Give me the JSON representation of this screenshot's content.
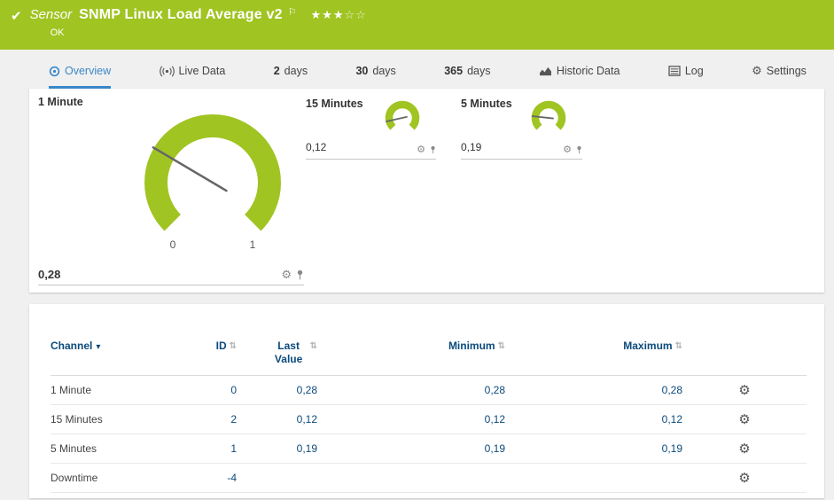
{
  "colors": {
    "brand_green": "#a0c422",
    "link_blue": "#3a87c8",
    "navy": "#0b4a7c"
  },
  "header": {
    "check_icon": "✔",
    "kind": "Sensor",
    "title": "SNMP Linux Load Average v2",
    "flag_icon": "⚐",
    "stars_filled": "★★★",
    "stars_empty": "☆☆",
    "status": "OK"
  },
  "tabs": [
    {
      "label": "Overview",
      "active": true
    },
    {
      "label": "Live Data"
    },
    {
      "prefix": "2",
      "label": "days"
    },
    {
      "prefix": "30",
      "label": "days"
    },
    {
      "prefix": "365",
      "label": "days"
    },
    {
      "label": "Historic Data"
    },
    {
      "label": "Log"
    },
    {
      "label": "Settings"
    }
  ],
  "gauges": {
    "primary": {
      "label": "1 Minute",
      "value": "0,28",
      "value_num": 0.28,
      "scale_min": "0",
      "scale_max": "1"
    },
    "small": [
      {
        "label": "15 Minutes",
        "value": "0,12",
        "value_num": 0.12
      },
      {
        "label": "5 Minutes",
        "value": "0,19",
        "value_num": 0.19
      }
    ]
  },
  "icons": {
    "gear": "⚙",
    "sort": "⇅",
    "caret": "▾"
  },
  "table": {
    "headers": {
      "channel": "Channel",
      "id": "ID",
      "last": "Last Value",
      "min": "Minimum",
      "max": "Maximum"
    },
    "rows": [
      {
        "channel": "1 Minute",
        "id": "0",
        "last": "0,28",
        "min": "0,28",
        "max": "0,28"
      },
      {
        "channel": "15 Minutes",
        "id": "2",
        "last": "0,12",
        "min": "0,12",
        "max": "0,12"
      },
      {
        "channel": "5 Minutes",
        "id": "1",
        "last": "0,19",
        "min": "0,19",
        "max": "0,19"
      },
      {
        "channel": "Downtime",
        "id": "-4",
        "last": "",
        "min": "",
        "max": ""
      }
    ]
  }
}
